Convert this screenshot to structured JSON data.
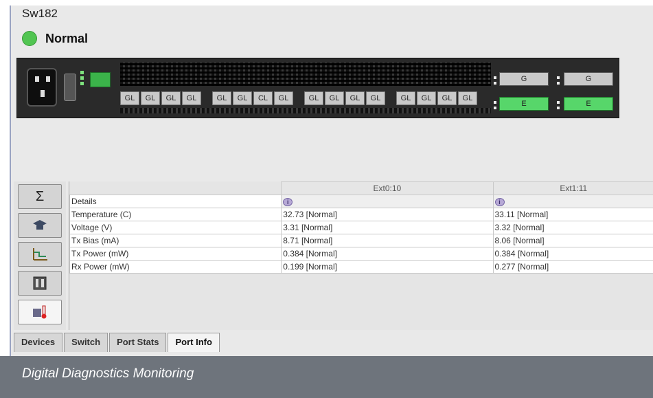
{
  "header": {
    "device_name": "Sw182",
    "status_label": "Normal",
    "status_color": "#52c552"
  },
  "switch_panel": {
    "gl_groups": [
      [
        "GL",
        "GL",
        "GL",
        "GL"
      ],
      [
        "GL",
        "GL",
        "CL",
        "GL"
      ],
      [
        "GL",
        "GL",
        "GL",
        "GL"
      ],
      [
        "GL",
        "GL",
        "GL",
        "GL"
      ]
    ],
    "ge_ports": {
      "top_left": "G",
      "top_right": "G",
      "bottom_left": "E",
      "bottom_right": "E"
    },
    "mgmt_port_color": "#3bb34a",
    "e_port_color": "#57d66a"
  },
  "sidebar": {
    "icons": [
      "sigma-icon",
      "graduation-cap-icon",
      "chart-axis-icon",
      "port-icon",
      "thermometer-icon"
    ],
    "sigma_glyph": "Σ"
  },
  "details_table": {
    "columns": [
      "Ext0:10",
      "Ext1:11"
    ],
    "details_label": "Details",
    "info_glyph": "i",
    "rows": [
      {
        "label": "Temperature (C)",
        "v1": "32.73 [Normal]",
        "v2": "33.11 [Normal]"
      },
      {
        "label": "Voltage (V)",
        "v1": "3.31 [Normal]",
        "v2": "3.32 [Normal]"
      },
      {
        "label": "Tx Bias (mA)",
        "v1": "8.71 [Normal]",
        "v2": "8.06 [Normal]"
      },
      {
        "label": "Tx Power (mW)",
        "v1": "0.384 [Normal]",
        "v2": "0.384 [Normal]"
      },
      {
        "label": "Rx Power (mW)",
        "v1": "0.199 [Normal]",
        "v2": "0.277 [Normal]"
      }
    ]
  },
  "tabs": [
    {
      "label": "Devices",
      "active": false
    },
    {
      "label": "Switch",
      "active": false
    },
    {
      "label": "Port Stats",
      "active": false
    },
    {
      "label": "Port Info",
      "active": true
    }
  ],
  "caption": "Digital Diagnostics Monitoring"
}
